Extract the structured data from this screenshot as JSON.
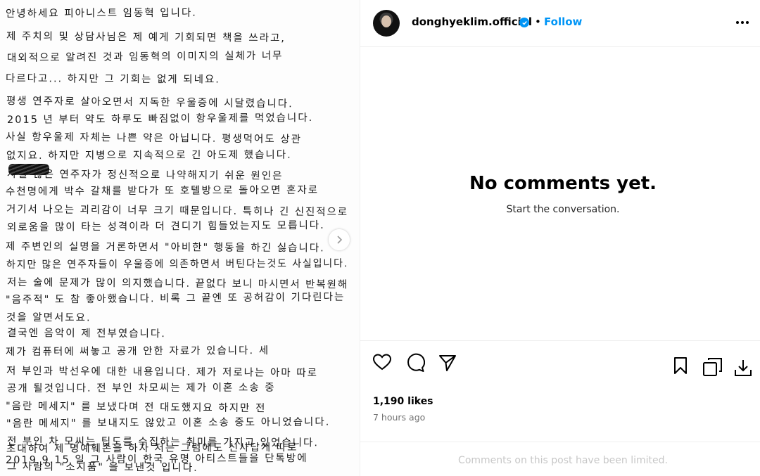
{
  "post": {
    "handwritten_lines": [
      "안녕하세요 피아니스트 임동혁 입니다.",
      "제 주치의 및 상담사님은 제 예게 기회되면 책을 쓰라고,",
      "대외적으로 알려진 것과 임동혁의 이미지의 실체가 너무",
      "다르다고... 하지만 그 기회는 없게 되네요.",
      "평생 연주자로 살아오면서 지독한 우울증에 시달렸습니다.",
      "2015 년 부터 약도 하루도 빠짐없이 항우울제를 먹었습니다.",
      "사실 항우울제 자체는 나쁜 약은 아닙니다. 평생먹어도 상관",
      "없지요. 하지만 지병으로 지속적으로 긴 아도제 했습니다.",
      "사실 많은 연주자가 정신적으로 나약해지기 쉬운 원인은",
      "수천명에게 박수 갈채를 받다가 또 호텔방으로 돌아오면 혼자로",
      "거기서 나오는 괴리감이 너무 크기 때문입니다. 특히나 긴 신진적으로",
      "외로움을 많이 타는 성격이라 더 견디기 힘들었는지도 모릅니다.",
      "제 주변인의 실명을 거론하면서 \"아비한\" 행동을 하긴 싫습니다.",
      "하지만 많은 연주자들이 우울증에 의존하면서 버틴다는것도 사실입니다.",
      "저는 술에 문제가 많이 의지했습니다. 끝없다 보니 마시면서 반복원해",
      "\"음주적\" 도 참 좋아했습니다. 비록 그 끝엔 또 공허감이 기다린다는",
      "것을 알면서도요.",
      "결국엔 음악이 제 전부였습니다.",
      "제가 컴퓨터에 써놓고 공개 안한 자료가 있습니다. 세",
      "저 부인과 박선우에 대한 내용입니다. 제가 저로나는 아마 따로",
      "공개 될것입니다. 전 부인 차모씨는 제가 이혼 소송 중",
      "\"음란 메세지\" 를 보냈다며 전 대도했지요 하지만 전",
      "\"음란 메세지\" 를 보내지도 않았고 이혼 소송 중도 아니었습니다.",
      "전 부인 차 모씨는 팁도를 수집하는 취미를 가지고 있었습니다.",
      "2019 9.15 일 그 사람이 한국 유명 아티스트들을 단톡방에",
      "초대하여 제 명예훼손을 하자 저는 그럼에도 신사답게 따로",
      "그 사람의 \"소지품\" 을 보낸것 입니다."
    ]
  },
  "header": {
    "username": "donghyeklim.official",
    "separator": "•",
    "follow_label": "Follow",
    "more_icon": "more-horizontal-icon"
  },
  "comments": {
    "empty_title": "No comments yet.",
    "empty_subtitle": "Start the conversation.",
    "limited_notice": "Comments on this post have been limited."
  },
  "actions": {
    "likes_text": "1,190 likes",
    "time_text": "7 hours ago",
    "icons": [
      "heart-icon",
      "comment-icon",
      "share-icon",
      "bookmark-icon",
      "copy-icon",
      "download-icon"
    ]
  },
  "colors": {
    "accent": "#0095f6",
    "muted": "#737373",
    "disabled_text": "#c7c7c7"
  }
}
